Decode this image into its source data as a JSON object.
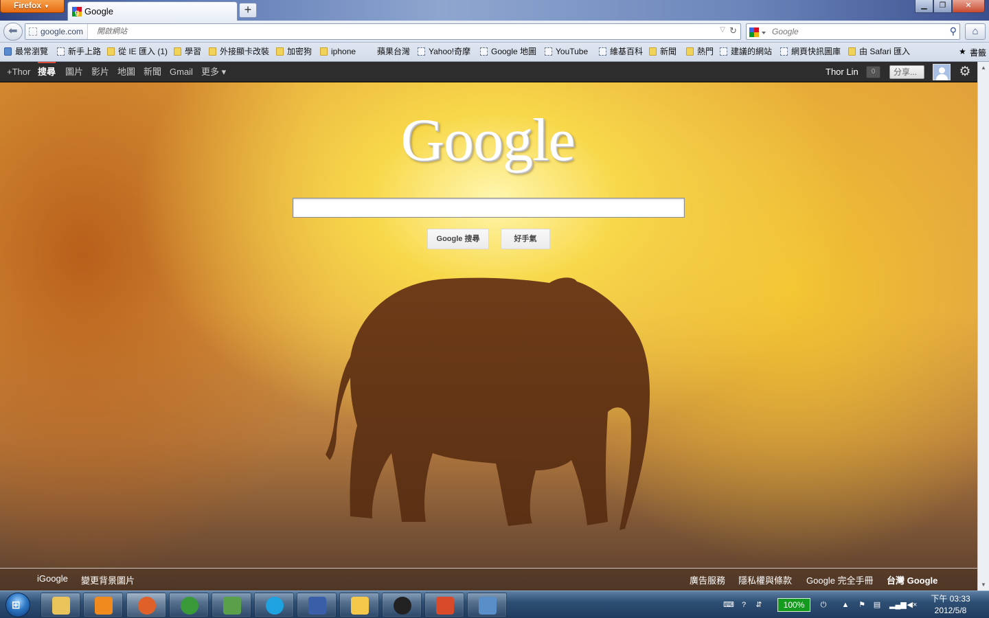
{
  "window": {
    "app_menu_label": "Firefox",
    "tab_title": "Google",
    "new_tab_label": "+"
  },
  "navbar": {
    "site_identity": "google.com",
    "url_placeholder": "開啟網站",
    "search_placeholder": "Google"
  },
  "bookmarks": [
    {
      "label": "最常瀏覽",
      "icon": "blue"
    },
    {
      "label": "新手上路",
      "icon": "page"
    },
    {
      "label": "從 IE 匯入 (1)",
      "icon": "folder"
    },
    {
      "label": "學習",
      "icon": "folder"
    },
    {
      "label": "外接顯卡改裝",
      "icon": "folder"
    },
    {
      "label": "加密狗",
      "icon": "folder"
    },
    {
      "label": "iphone",
      "icon": "folder"
    },
    {
      "label": "蘋果台灣",
      "icon": "apple"
    },
    {
      "label": "Yahoo!奇摩",
      "icon": "page"
    },
    {
      "label": "Google 地圖",
      "icon": "page"
    },
    {
      "label": "YouTube",
      "icon": "page"
    },
    {
      "label": "維基百科",
      "icon": "page"
    },
    {
      "label": "新聞",
      "icon": "folder"
    },
    {
      "label": "熱門",
      "icon": "folder"
    },
    {
      "label": "建議的網站",
      "icon": "page"
    },
    {
      "label": "網頁快訊圖庫",
      "icon": "page"
    },
    {
      "label": "由 Safari 匯入",
      "icon": "folder"
    }
  ],
  "bookmarks_menu_label": "書籤",
  "gbar": {
    "items": [
      "+Thor",
      "搜尋",
      "圖片",
      "影片",
      "地圖",
      "新聞",
      "Gmail",
      "更多 ▾"
    ],
    "active_index": 1,
    "user_name": "Thor Lin",
    "notification_count": "0",
    "share_placeholder": "分享..."
  },
  "page": {
    "logo_text": "Google",
    "search_value": "",
    "search_button": "Google 搜尋",
    "lucky_button": "好手氣"
  },
  "footer": {
    "left": [
      "iGoogle",
      "變更背景圖片"
    ],
    "right": [
      "廣告服務",
      "隱私權與條款",
      "Google 完全手冊",
      "台灣 Google"
    ]
  },
  "taskbar": {
    "battery": "100%",
    "clock_time": "下午 03:33",
    "clock_date": "2012/5/8",
    "apps": [
      {
        "name": "explorer-icon",
        "color": "#e8c45a"
      },
      {
        "name": "media-player-icon",
        "color": "#f08a1e"
      },
      {
        "name": "firefox-icon",
        "color": "#e0602a"
      },
      {
        "name": "chrome-icon",
        "color": "#3a9a3a"
      },
      {
        "name": "messenger-icon",
        "color": "#5aa04a"
      },
      {
        "name": "skype-icon",
        "color": "#1fa3e0"
      },
      {
        "name": "infinity-app-icon",
        "color": "#3b5ea8"
      },
      {
        "name": "mail-icon",
        "color": "#f4c84a"
      },
      {
        "name": "ultraedit-icon",
        "color": "#222222"
      },
      {
        "name": "control-panel-icon",
        "color": "#d94a2a"
      },
      {
        "name": "photo-viewer-icon",
        "color": "#5a8ec8"
      }
    ]
  },
  "colors": {
    "gbar_bg": "#2d2d2d",
    "gbar_active": "#dd4b39",
    "accent_orange": "#e66a10"
  }
}
